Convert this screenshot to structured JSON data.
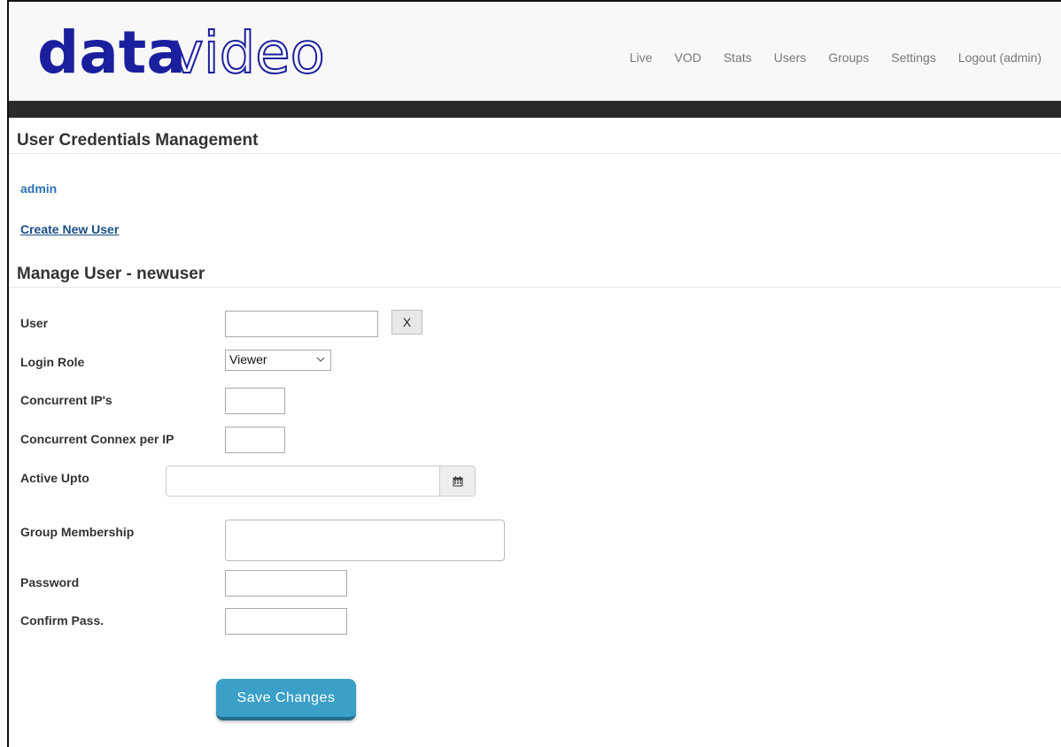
{
  "brand": {
    "logo_bold": "data",
    "logo_outline": "video",
    "colors": {
      "logo": "#1b1f9e",
      "accent": "#3aa0c8",
      "link": "#2a72b5"
    }
  },
  "nav": {
    "items": [
      "Live",
      "VOD",
      "Stats",
      "Users",
      "Groups",
      "Settings",
      "Logout (admin)"
    ]
  },
  "credentials": {
    "title": "User Credentials Management",
    "current_user": "admin",
    "create_link": "Create New User"
  },
  "manage": {
    "title": "Manage User - newuser",
    "fields": {
      "user_label": "User",
      "user_value": "",
      "clear_label": "X",
      "role_label": "Login Role",
      "role_selected": "Viewer",
      "ips_label": "Concurrent IP's",
      "ips_value": "",
      "connex_label": "Concurrent Connex per IP",
      "connex_value": "",
      "active_label": "Active Upto",
      "active_value": "",
      "group_label": "Group Membership",
      "password_label": "Password",
      "confirm_label": "Confirm Pass."
    },
    "save_label": "Save Changes",
    "icons": {
      "calendar": "calendar-icon",
      "chevron": "chevron-down-icon"
    }
  }
}
